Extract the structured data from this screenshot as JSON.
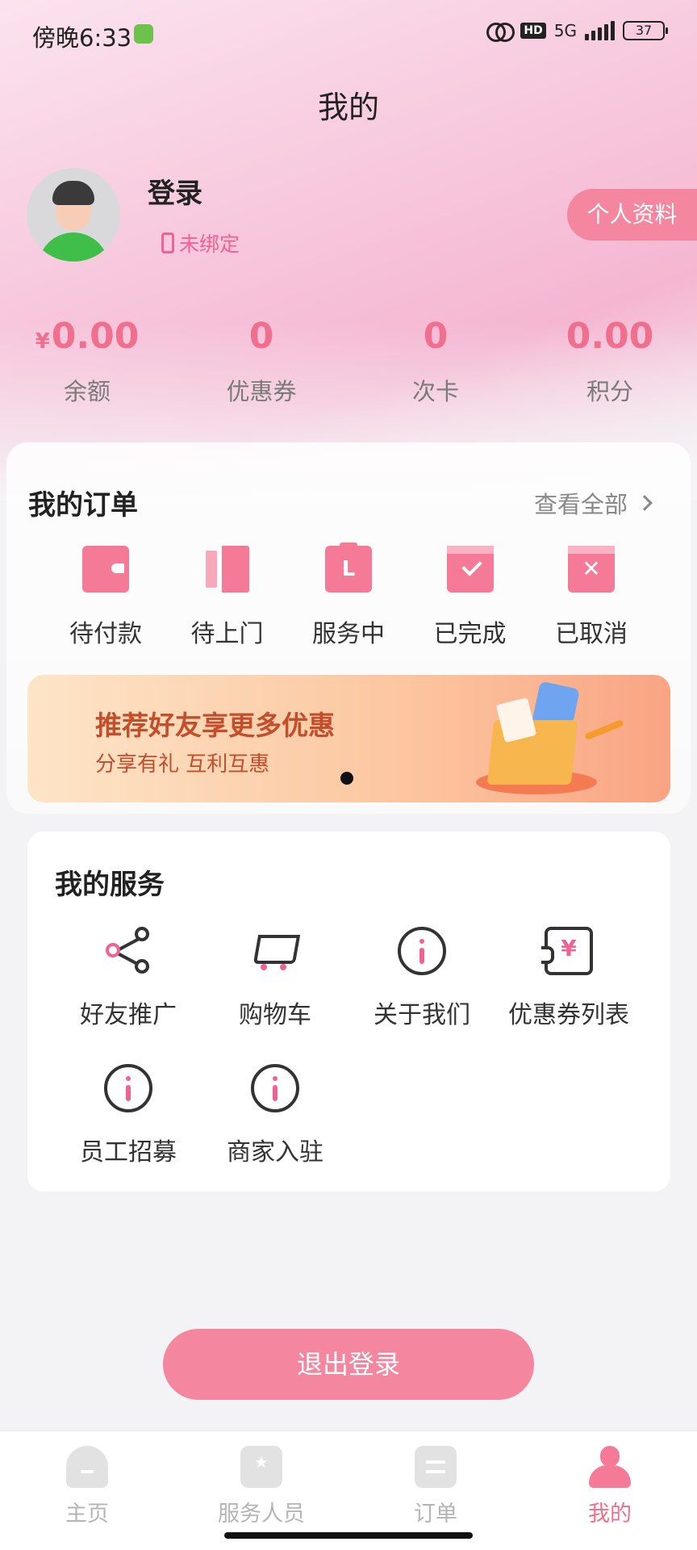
{
  "status_bar": {
    "time": "傍晚6:33",
    "network": "5G",
    "hd": "HD",
    "battery": "37"
  },
  "header": {
    "title": "我的"
  },
  "profile": {
    "login_text": "登录",
    "phone_status": "未绑定",
    "profile_button": "个人资料"
  },
  "stats": [
    {
      "currency": "¥",
      "value": "0.00",
      "label": "余额"
    },
    {
      "currency": "",
      "value": "0",
      "label": "优惠券"
    },
    {
      "currency": "",
      "value": "0",
      "label": "次卡"
    },
    {
      "currency": "",
      "value": "0.00",
      "label": "积分"
    }
  ],
  "orders": {
    "title": "我的订单",
    "view_all": "查看全部",
    "items": [
      {
        "label": "待付款",
        "icon": "wallet-icon"
      },
      {
        "label": "待上门",
        "icon": "door-icon"
      },
      {
        "label": "服务中",
        "icon": "clipboard-icon"
      },
      {
        "label": "已完成",
        "icon": "check-box-icon"
      },
      {
        "label": "已取消",
        "icon": "cancel-box-icon"
      }
    ]
  },
  "banner": {
    "title": "推荐好友享更多优惠",
    "subtitle": "分享有礼 互利互惠"
  },
  "services": {
    "title": "我的服务",
    "items": [
      {
        "label": "好友推广",
        "icon": "share-icon"
      },
      {
        "label": "购物车",
        "icon": "cart-icon"
      },
      {
        "label": "关于我们",
        "icon": "info-icon"
      },
      {
        "label": "优惠券列表",
        "icon": "coupon-icon"
      },
      {
        "label": "员工招募",
        "icon": "info-icon"
      },
      {
        "label": "商家入驻",
        "icon": "info-icon"
      }
    ]
  },
  "logout_button": "退出登录",
  "tab_bar": {
    "active": "我的",
    "tabs": [
      {
        "label": "主页",
        "icon": "home-icon"
      },
      {
        "label": "服务人员",
        "icon": "staff-icon"
      },
      {
        "label": "订单",
        "icon": "order-icon"
      },
      {
        "label": "我的",
        "icon": "profile-icon"
      }
    ]
  },
  "colors": {
    "accent": "#f06f8f",
    "button": "#f4869f",
    "banner_text": "#c24e2c"
  }
}
